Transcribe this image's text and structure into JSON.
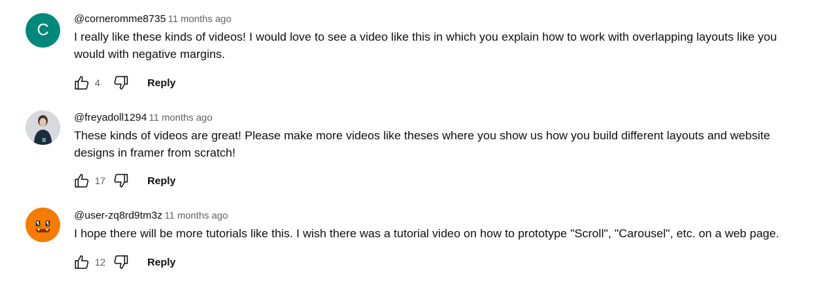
{
  "comments": [
    {
      "author": "@corneromme8735",
      "time": "11 months ago",
      "text": "I really like these kinds of videos! I would love to see a video like this in which you explain how to work with overlapping layouts like you would with negative margins.",
      "likes": "4",
      "reply_label": "Reply",
      "avatar": {
        "type": "letter",
        "letter": "C",
        "color": "#00897b"
      }
    },
    {
      "author": "@freyadoll1294",
      "time": "11 months ago",
      "text": "These kinds of videos are great! Please make more videos like theses where you show us how you build different layouts and website designs in framer from scratch!",
      "likes": "17",
      "reply_label": "Reply",
      "avatar": {
        "type": "photo",
        "color": "#cfd3d8"
      }
    },
    {
      "author": "@user-zq8rd9tm3z",
      "time": "11 months ago",
      "text": "I hope there will be more tutorials like this. I wish there was a tutorial video on how to prototype \"Scroll\", \"Carousel\", etc. on a web page.",
      "likes": "12",
      "reply_label": "Reply",
      "avatar": {
        "type": "illustration",
        "color": "#f57c00"
      }
    }
  ],
  "icons": {
    "like": "thumbs-up-icon",
    "dislike": "thumbs-down-icon"
  }
}
